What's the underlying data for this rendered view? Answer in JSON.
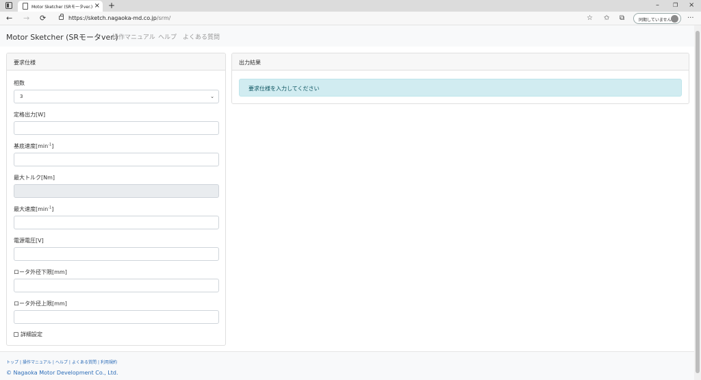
{
  "browser": {
    "tab_title": "Motor Sketcher (SRモータver.) | 操",
    "tab_close": "×",
    "new_tab": "+",
    "url_host": "https://sketch.nagaoka-md.co.jp",
    "url_path": "/srm/",
    "profile_label": "同期していません",
    "back_icon": "←",
    "forward_icon": "→",
    "refresh_icon": "⟳",
    "fav_icon": "☆",
    "favorites_icon": "✩",
    "collections_icon": "⧉",
    "more_icon": "···",
    "minimize": "–",
    "restore": "❐",
    "close": "×"
  },
  "nav": {
    "brand": "Motor Sketcher (SRモータver.)",
    "links": [
      "操作マニュアル",
      "ヘルプ",
      "よくある質問"
    ]
  },
  "form": {
    "header": "要求仕様",
    "phase_label": "相数",
    "phase_value": "3",
    "rated_output_label": "定格出力[W]",
    "base_speed_label": "基底速度[min",
    "base_speed_sup": "-1",
    "bracket_close": "]",
    "max_torque_label": "最大トルク[Nm]",
    "max_speed_label": "最大速度[min",
    "max_speed_sup": "-1",
    "voltage_label": "電源電圧[V]",
    "rotor_min_label": "ロータ外径下限[mm]",
    "rotor_max_label": "ロータ外径上限[mm]",
    "detail_label": "詳細設定"
  },
  "result": {
    "header": "出力結果",
    "message": "要求仕様を入力してください"
  },
  "footer": {
    "links": [
      "トップ",
      "操作マニュアル",
      "ヘルプ",
      "よくある質問",
      "利用規約"
    ],
    "separator": "|",
    "copyright": "© Nagaoka Motor Development Co., Ltd."
  }
}
